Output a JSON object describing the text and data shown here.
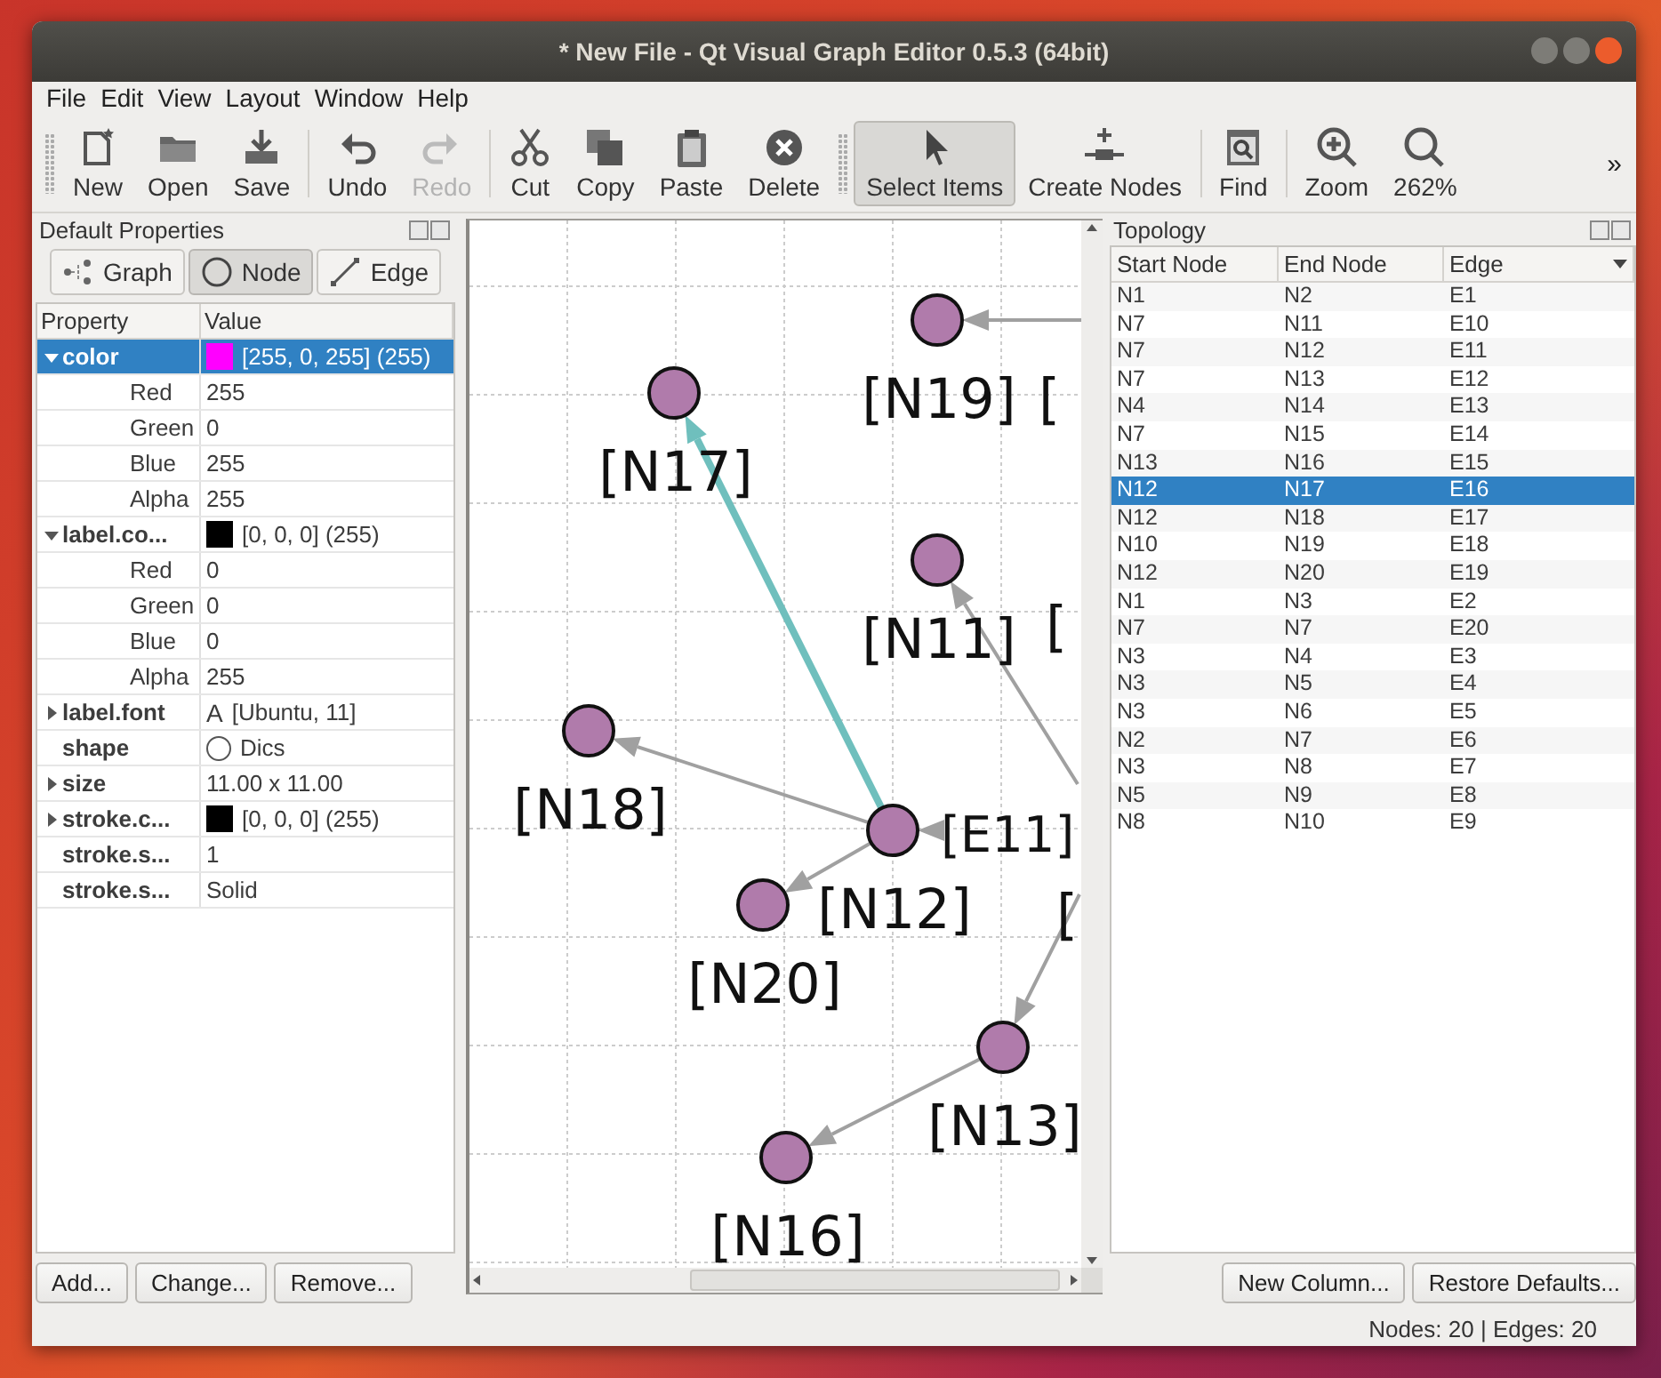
{
  "window": {
    "title": "* New File - Qt Visual Graph Editor 0.5.3 (64bit)"
  },
  "menu": [
    "File",
    "Edit",
    "View",
    "Layout",
    "Window",
    "Help"
  ],
  "toolbar": {
    "groups": [
      [
        {
          "label": "New",
          "disabled": false,
          "selected": false
        },
        {
          "label": "Open",
          "disabled": false,
          "selected": false
        },
        {
          "label": "Save",
          "disabled": false,
          "selected": false
        }
      ],
      [
        {
          "label": "Undo",
          "disabled": false,
          "selected": false
        },
        {
          "label": "Redo",
          "disabled": true,
          "selected": false
        }
      ],
      [
        {
          "label": "Cut",
          "disabled": false,
          "selected": false
        },
        {
          "label": "Copy",
          "disabled": false,
          "selected": false
        },
        {
          "label": "Paste",
          "disabled": false,
          "selected": false
        },
        {
          "label": "Delete",
          "disabled": false,
          "selected": false
        }
      ],
      [
        {
          "label": "Select Items",
          "disabled": false,
          "selected": true
        },
        {
          "label": "Create Nodes",
          "disabled": false,
          "selected": false
        }
      ],
      [
        {
          "label": "Find",
          "disabled": false,
          "selected": false
        }
      ],
      [
        {
          "label": "Zoom",
          "disabled": false,
          "selected": false
        },
        {
          "label": "262%",
          "disabled": false,
          "selected": false
        }
      ]
    ],
    "overflow": "»"
  },
  "properties_dock": {
    "title": "Default Properties",
    "tabs": [
      {
        "label": "Graph",
        "selected": false
      },
      {
        "label": "Node",
        "selected": true
      },
      {
        "label": "Edge",
        "selected": false
      }
    ],
    "columns": [
      "Property",
      "Value"
    ],
    "rows": [
      {
        "name": "color",
        "value": "[255, 0, 255] (255)",
        "kind": "color",
        "color": "#ff00ff",
        "expanded": true,
        "selected": true,
        "children": [
          {
            "name": "Red",
            "value": "255",
            "selected": false
          },
          {
            "name": "Green",
            "value": "0",
            "selected": false
          },
          {
            "name": "Blue",
            "value": "255",
            "selected": false
          },
          {
            "name": "Alpha",
            "value": "255",
            "selected": false
          }
        ]
      },
      {
        "name": "label.co...",
        "value": "[0, 0, 0] (255)",
        "kind": "color",
        "color": "#000000",
        "expanded": true,
        "selected": false,
        "children": [
          {
            "name": "Red",
            "value": "0",
            "selected": false
          },
          {
            "name": "Green",
            "value": "0",
            "selected": false
          },
          {
            "name": "Blue",
            "value": "0",
            "selected": false
          },
          {
            "name": "Alpha",
            "value": "255",
            "selected": false
          }
        ]
      },
      {
        "name": "label.font",
        "value": "[Ubuntu, 11]",
        "kind": "font",
        "glyph": "A",
        "expanded": false,
        "selected": false
      },
      {
        "name": "shape",
        "value": "Dics",
        "kind": "shape",
        "selected": false
      },
      {
        "name": "size",
        "value": "11.00 x 11.00",
        "expanded": false,
        "selected": false
      },
      {
        "name": "stroke.c...",
        "value": "[0, 0, 0] (255)",
        "kind": "color",
        "color": "#000000",
        "expanded": false,
        "selected": false
      },
      {
        "name": "stroke.s...",
        "value": "1",
        "selected": false
      },
      {
        "name": "stroke.s...",
        "value": "Solid",
        "selected": false
      }
    ],
    "buttons": [
      "Add...",
      "Change...",
      "Remove..."
    ]
  },
  "canvas": {
    "nodes": [
      {
        "label": "[N19]"
      },
      {
        "label": "[N17]"
      },
      {
        "label": "[N11]"
      },
      {
        "label": "[N18]"
      },
      {
        "label": "[N12]"
      },
      {
        "label": "[N20]"
      },
      {
        "label": "[N13]"
      },
      {
        "label": "[N16]"
      }
    ],
    "edges": [
      {
        "selected": false
      },
      {
        "selected": true
      },
      {
        "selected": false
      },
      {
        "selected": false
      },
      {
        "selected": false
      },
      {
        "selected": false
      },
      {
        "selected": false
      },
      {
        "selected": false
      }
    ],
    "edge_labels": [
      {
        "text": "[E11]"
      }
    ],
    "partial_labels": [
      {
        "text": "["
      },
      {
        "text": "["
      },
      {
        "text": "["
      }
    ]
  },
  "topology_dock": {
    "title": "Topology",
    "columns": [
      "Start Node",
      "End Node",
      "Edge"
    ],
    "rows": [
      {
        "cells": [
          "N1",
          "N2",
          "E1"
        ],
        "selected": false
      },
      {
        "cells": [
          "N7",
          "N11",
          "E10"
        ],
        "selected": false
      },
      {
        "cells": [
          "N7",
          "N12",
          "E11"
        ],
        "selected": false
      },
      {
        "cells": [
          "N7",
          "N13",
          "E12"
        ],
        "selected": false
      },
      {
        "cells": [
          "N4",
          "N14",
          "E13"
        ],
        "selected": false
      },
      {
        "cells": [
          "N7",
          "N15",
          "E14"
        ],
        "selected": false
      },
      {
        "cells": [
          "N13",
          "N16",
          "E15"
        ],
        "selected": false
      },
      {
        "cells": [
          "N12",
          "N17",
          "E16"
        ],
        "selected": true
      },
      {
        "cells": [
          "N12",
          "N18",
          "E17"
        ],
        "selected": false
      },
      {
        "cells": [
          "N10",
          "N19",
          "E18"
        ],
        "selected": false
      },
      {
        "cells": [
          "N12",
          "N20",
          "E19"
        ],
        "selected": false
      },
      {
        "cells": [
          "N1",
          "N3",
          "E2"
        ],
        "selected": false
      },
      {
        "cells": [
          "N7",
          "N7",
          "E20"
        ],
        "selected": false
      },
      {
        "cells": [
          "N3",
          "N4",
          "E3"
        ],
        "selected": false
      },
      {
        "cells": [
          "N3",
          "N5",
          "E4"
        ],
        "selected": false
      },
      {
        "cells": [
          "N3",
          "N6",
          "E5"
        ],
        "selected": false
      },
      {
        "cells": [
          "N2",
          "N7",
          "E6"
        ],
        "selected": false
      },
      {
        "cells": [
          "N3",
          "N8",
          "E7"
        ],
        "selected": false
      },
      {
        "cells": [
          "N5",
          "N9",
          "E8"
        ],
        "selected": false
      },
      {
        "cells": [
          "N8",
          "N10",
          "E9"
        ],
        "selected": false
      }
    ],
    "buttons": [
      "New Column...",
      "Restore Defaults..."
    ]
  },
  "status_bar": "Nodes: 20 | Edges: 20"
}
